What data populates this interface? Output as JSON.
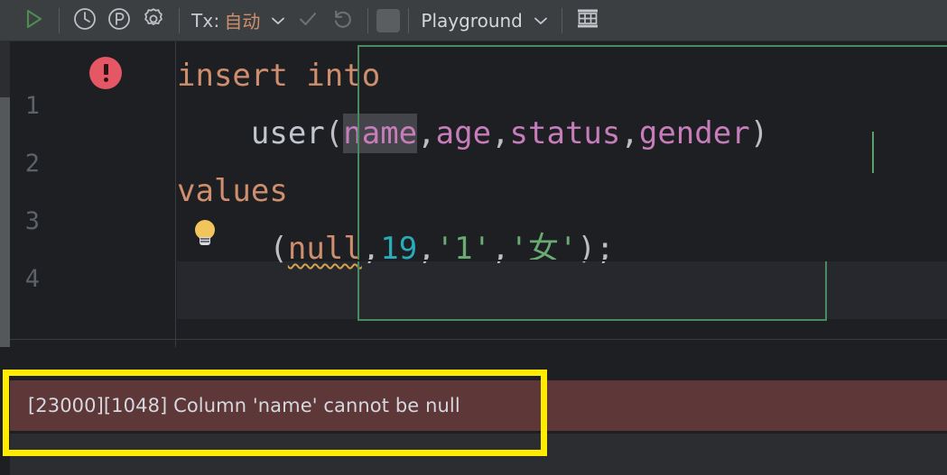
{
  "toolbar": {
    "run_label": "run-query",
    "history_label": "history",
    "profile_label": "p-circle",
    "settings_label": "settings",
    "tx": {
      "label": "Tx:",
      "value": "自动",
      "chevron": "chevron-down-icon"
    },
    "commit_label": "commit",
    "rollback_label": "rollback",
    "session": {
      "label": "Playground",
      "chevron": "chevron-down-icon"
    },
    "grid_label": "show-table"
  },
  "editor": {
    "gutter": {
      "lines": [
        "1",
        "2",
        "3",
        "4"
      ],
      "error_marker_line": "1",
      "error_marker_icon": "error-circle-icon"
    },
    "intention_icon": "lightbulb-icon",
    "code_lines": [
      {
        "tokens": [
          {
            "text": "insert into",
            "kind": "kw"
          }
        ]
      },
      {
        "tokens": [
          {
            "text": "    ",
            "kind": "pad"
          },
          {
            "text": "user",
            "kind": "id"
          },
          {
            "text": "(",
            "kind": "punc"
          },
          {
            "text": "name",
            "kind": "hl"
          },
          {
            "text": ",",
            "kind": "punc"
          },
          {
            "text": "age",
            "kind": "col"
          },
          {
            "text": ",",
            "kind": "punc"
          },
          {
            "text": "status",
            "kind": "col"
          },
          {
            "text": ",",
            "kind": "punc"
          },
          {
            "text": "gender",
            "kind": "col"
          },
          {
            "text": ")",
            "kind": "punc"
          }
        ]
      },
      {
        "tokens": [
          {
            "text": "values",
            "kind": "kw"
          }
        ]
      },
      {
        "tokens": [
          {
            "text": "     ",
            "kind": "pad"
          },
          {
            "text": "(",
            "kind": "punc"
          },
          {
            "text": "null",
            "kind": "squiggle"
          },
          {
            "text": ",",
            "kind": "punc"
          },
          {
            "text": "19",
            "kind": "num"
          },
          {
            "text": ",",
            "kind": "punc"
          },
          {
            "text": "'1'",
            "kind": "str"
          },
          {
            "text": ",",
            "kind": "punc"
          },
          {
            "text": "'女'",
            "kind": "str"
          },
          {
            "text": ")",
            "kind": "punc"
          },
          {
            "text": ";",
            "kind": "punc"
          }
        ]
      }
    ]
  },
  "results": {
    "error_message": "[23000][1048] Column 'name' cannot be null"
  },
  "colors": {
    "accent_green": "#4a8a5c",
    "error_bg": "#5e3838",
    "error_marker": "#e55765",
    "annotation": "#ffeb00",
    "keyword": "#cf8e6d",
    "column": "#c77dbb",
    "number": "#2aacb8",
    "string": "#6aab73"
  }
}
